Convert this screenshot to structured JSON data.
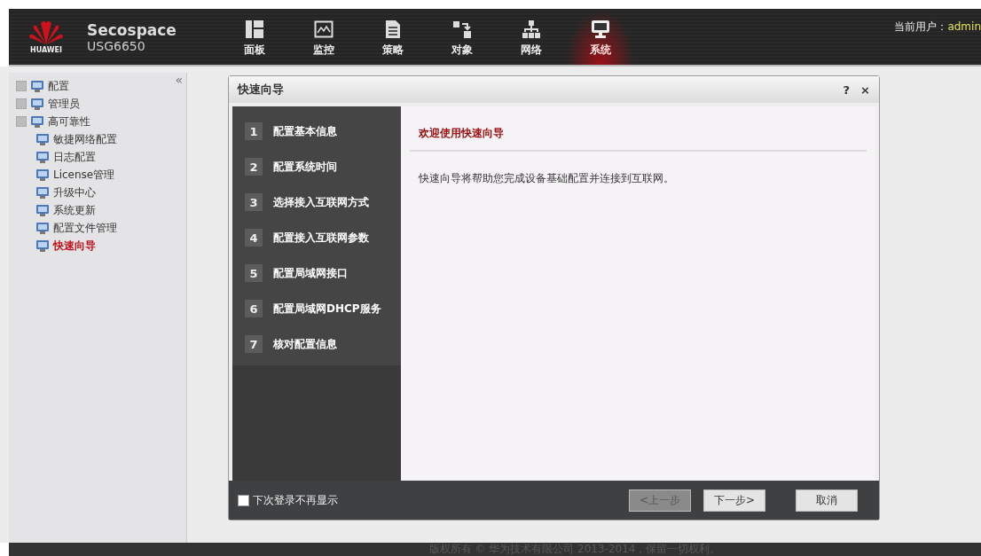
{
  "brand": {
    "logo_text": "HUAWEI",
    "product": "Secospace",
    "model": "USG6650"
  },
  "nav": [
    {
      "label": "面板",
      "selected": false
    },
    {
      "label": "监控",
      "selected": false
    },
    {
      "label": "策略",
      "selected": false
    },
    {
      "label": "对象",
      "selected": false
    },
    {
      "label": "网络",
      "selected": false
    },
    {
      "label": "系统",
      "selected": true
    }
  ],
  "user": {
    "label": "当前用户：",
    "name": "admin"
  },
  "sidebar": {
    "collapse": "«",
    "items": [
      {
        "label": "配置",
        "kind": "group",
        "expanded": false,
        "selected": false
      },
      {
        "label": "管理员",
        "kind": "group",
        "expanded": false,
        "selected": false
      },
      {
        "label": "高可靠性",
        "kind": "group",
        "expanded": false,
        "selected": false
      },
      {
        "label": "敏捷网络配置",
        "kind": "leaf",
        "selected": false
      },
      {
        "label": "日志配置",
        "kind": "leaf",
        "selected": false
      },
      {
        "label": "License管理",
        "kind": "leaf",
        "selected": false
      },
      {
        "label": "升级中心",
        "kind": "leaf",
        "selected": false
      },
      {
        "label": "系统更新",
        "kind": "leaf",
        "selected": false
      },
      {
        "label": "配置文件管理",
        "kind": "leaf",
        "selected": false
      },
      {
        "label": "快速向导",
        "kind": "leaf",
        "selected": true
      }
    ]
  },
  "dialog": {
    "title": "快速向导",
    "help": "?",
    "close": "×",
    "steps": [
      {
        "number": "1",
        "label": "配置基本信息",
        "selected": false
      },
      {
        "number": "2",
        "label": "配置系统时间",
        "selected": false
      },
      {
        "number": "3",
        "label": "选择接入互联网方式",
        "selected": false
      },
      {
        "number": "4",
        "label": "配置接入互联网参数",
        "selected": false
      },
      {
        "number": "5",
        "label": "配置局域网接口",
        "selected": false
      },
      {
        "number": "6",
        "label": "配置局域网DHCP服务",
        "selected": false
      },
      {
        "number": "7",
        "label": "核对配置信息",
        "selected": false
      }
    ],
    "heading": "欢迎使用快速向导",
    "text": "快速向导将帮助您完成设备基础配置并连接到互联网。",
    "checkbox": {
      "label": "下次登录不再显示",
      "checked": false
    },
    "buttons": [
      {
        "label": "<上一步",
        "disabled": true
      },
      {
        "label": "下一步>",
        "disabled": false
      },
      {
        "label": "取消",
        "disabled": false
      }
    ]
  },
  "footer": "版权所有 © 华为技术有限公司 2013-2014，保留一切权利。"
}
